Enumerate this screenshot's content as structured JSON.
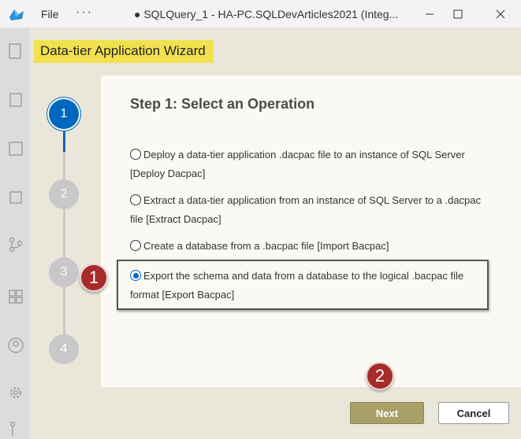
{
  "window": {
    "menu_file": "File",
    "menu_more": "···",
    "title": "● SQLQuery_1 - HA-PC.SQLDevArticles2021 (Integ..."
  },
  "dialog": {
    "title": "Data-tier Application Wizard",
    "step_heading": "Step 1: Select an Operation",
    "steps": [
      "1",
      "2",
      "3",
      "4"
    ],
    "active_step": 1,
    "options": [
      {
        "label": "Deploy a data-tier application .dacpac file to an instance of SQL Server [Deploy Dacpac]",
        "selected": false
      },
      {
        "label": "Extract a data-tier application from an instance of SQL Server to a .dacpac file [Extract Dacpac]",
        "selected": false
      },
      {
        "label": "Create a database from a .bacpac file [Import Bacpac]",
        "selected": false
      },
      {
        "label": "Export the schema and data from a database to the logical .bacpac file format [Export Bacpac]",
        "selected": true
      }
    ],
    "next_label": "Next",
    "cancel_label": "Cancel"
  },
  "callouts": [
    "1",
    "2"
  ],
  "colors": {
    "accent": "#0067c0",
    "title_highlight": "#f2e14f",
    "callout": "#a72b2b",
    "next_button": "#a9a068"
  },
  "icons": [
    "app-icon",
    "minimize-icon",
    "maximize-icon",
    "close-icon",
    "explorer-icon",
    "search-icon",
    "extensions-icon",
    "source-control-icon",
    "connections-icon",
    "account-icon",
    "settings-icon"
  ]
}
